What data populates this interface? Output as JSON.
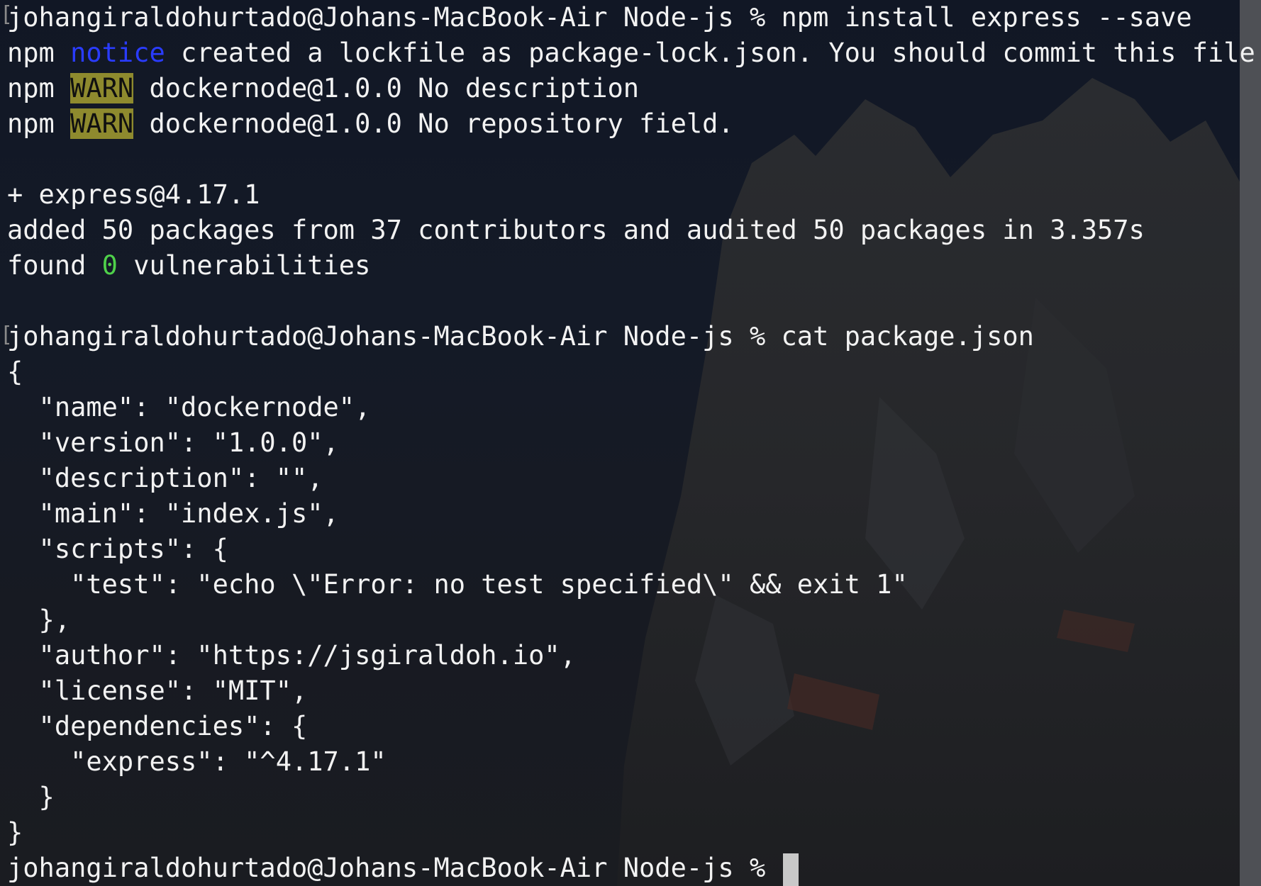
{
  "terminal": {
    "prompt": "johangiraldohurtado@Johans-MacBook-Air Node-js % ",
    "commands": {
      "install": "npm install express --save",
      "cat": "cat package.json"
    },
    "install_output": {
      "npm": "npm",
      "notice_tag": "notice",
      "notice_text": " created a lockfile as package-lock.json. You should commit this file.",
      "warn_tag": "WARN",
      "warn1_text": " dockernode@1.0.0 No description",
      "warn2_text": " dockernode@1.0.0 No repository field.",
      "added_pkg": "+ express@4.17.1",
      "added_summary": "added 50 packages from 37 contributors and audited 50 packages in 3.357s",
      "found_prefix": "found ",
      "found_count": "0",
      "found_suffix": " vulnerabilities"
    },
    "package_json_lines": [
      "{",
      "  \"name\": \"dockernode\",",
      "  \"version\": \"1.0.0\",",
      "  \"description\": \"\",",
      "  \"main\": \"index.js\",",
      "  \"scripts\": {",
      "    \"test\": \"echo \\\"Error: no test specified\\\" && exit 1\"",
      "  },",
      "  \"author\": \"https://jsgiraldoh.io\",",
      "  \"license\": \"MIT\",",
      "  \"dependencies\": {",
      "    \"express\": \"^4.17.1\"",
      "  }",
      "}"
    ]
  },
  "colors": {
    "notice": "#2a3cff",
    "warn_bg": "#8e8a2e",
    "success": "#4fd14a",
    "text": "#f2f2f2"
  }
}
